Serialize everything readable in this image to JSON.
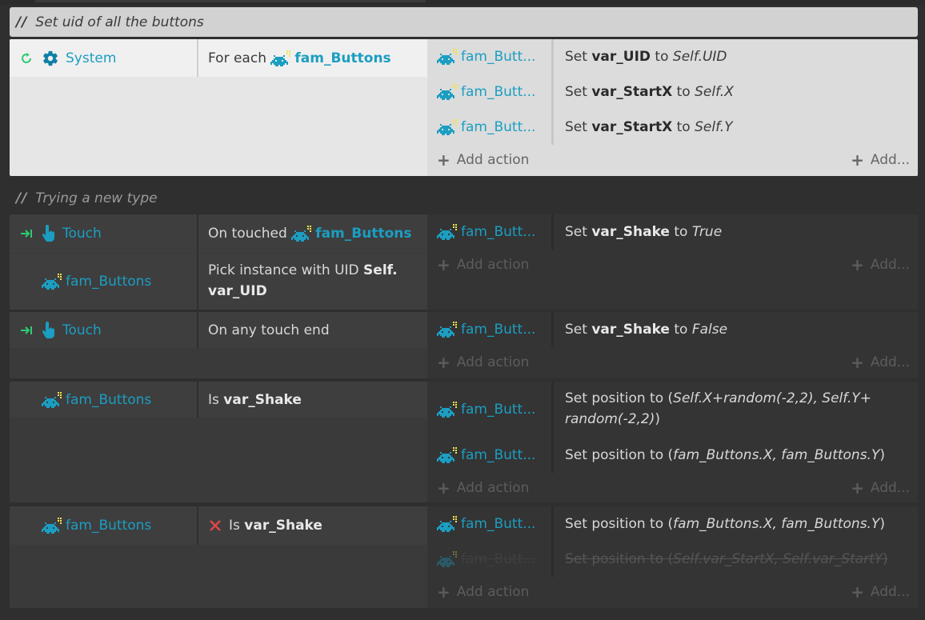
{
  "comments": {
    "c1": "Set uid of all the buttons",
    "c2": "Trying a new type",
    "slashes": "//"
  },
  "colors": {
    "accent": "#1b9ec2",
    "trigger_green": "#2ecc71",
    "invert_red": "#e04848"
  },
  "icons": {
    "loop": "loop-arrow-icon",
    "gear": "gear-icon",
    "invader": "space-invader-icon",
    "trigger": "trigger-arrow-icon",
    "hand": "touch-hand-icon",
    "invert": "invert-x-icon"
  },
  "block1": {
    "cond_object": "System",
    "cond_text_prefix": "For each",
    "cond_text_object": "fam_Buttons",
    "actions": [
      {
        "object": "fam_Butt...",
        "prefix": "Set ",
        "var": "var_UID",
        "mid": " to ",
        "value": "Self.UID"
      },
      {
        "object": "fam_Butt...",
        "prefix": "Set ",
        "var": "var_StartX",
        "mid": " to ",
        "value": "Self.X"
      },
      {
        "object": "fam_Butt...",
        "prefix": "Set ",
        "var": "var_StartX",
        "mid": " to ",
        "value": "Self.Y"
      }
    ]
  },
  "block2": {
    "cond1_object": "Touch",
    "cond1_text_prefix": "On touched",
    "cond1_text_object": "fam_Buttons",
    "cond2_object": "fam_Buttons",
    "cond2_text_prefix": "Pick instance with UID",
    "cond2_text_value": "Self.",
    "cond2_text_value2": "var_UID",
    "action": {
      "object": "fam_Butt...",
      "prefix": "Set ",
      "var": "var_Shake",
      "mid": " to ",
      "value": "True"
    }
  },
  "block3": {
    "cond_object": "Touch",
    "cond_text": "On any touch end",
    "action": {
      "object": "fam_Butt...",
      "prefix": "Set ",
      "var": "var_Shake",
      "mid": " to ",
      "value": "False"
    }
  },
  "block4": {
    "cond_object": "fam_Buttons",
    "cond_text_prefix": "Is",
    "cond_text_var": "var_Shake",
    "action1": {
      "object": "fam_Butt...",
      "prefix": "Set position to (",
      "value1": "Self.X+random(-2,2), Self.Y+",
      "value2": "random(-2,2)",
      "suffix": ")"
    },
    "action2": {
      "object": "fam_Butt...",
      "prefix": "Set position to (",
      "value": "fam_Buttons.X, fam_Buttons.Y",
      "suffix": ")"
    }
  },
  "block5": {
    "cond_object": "fam_Buttons",
    "cond_text_prefix": "Is",
    "cond_text_var": "var_Shake",
    "action1": {
      "object": "fam_Butt...",
      "prefix": "Set position to (",
      "value": "fam_Buttons.X, fam_Buttons.Y",
      "suffix": ")"
    },
    "action2": {
      "object": "fam_Butt...",
      "prefix": "Set position to (",
      "value": "Self.var_StartX, Self.var_StartY",
      "suffix": ")"
    }
  },
  "add_action_label": "Add action",
  "add_short_label": "Add...",
  "plus_sign": "+"
}
